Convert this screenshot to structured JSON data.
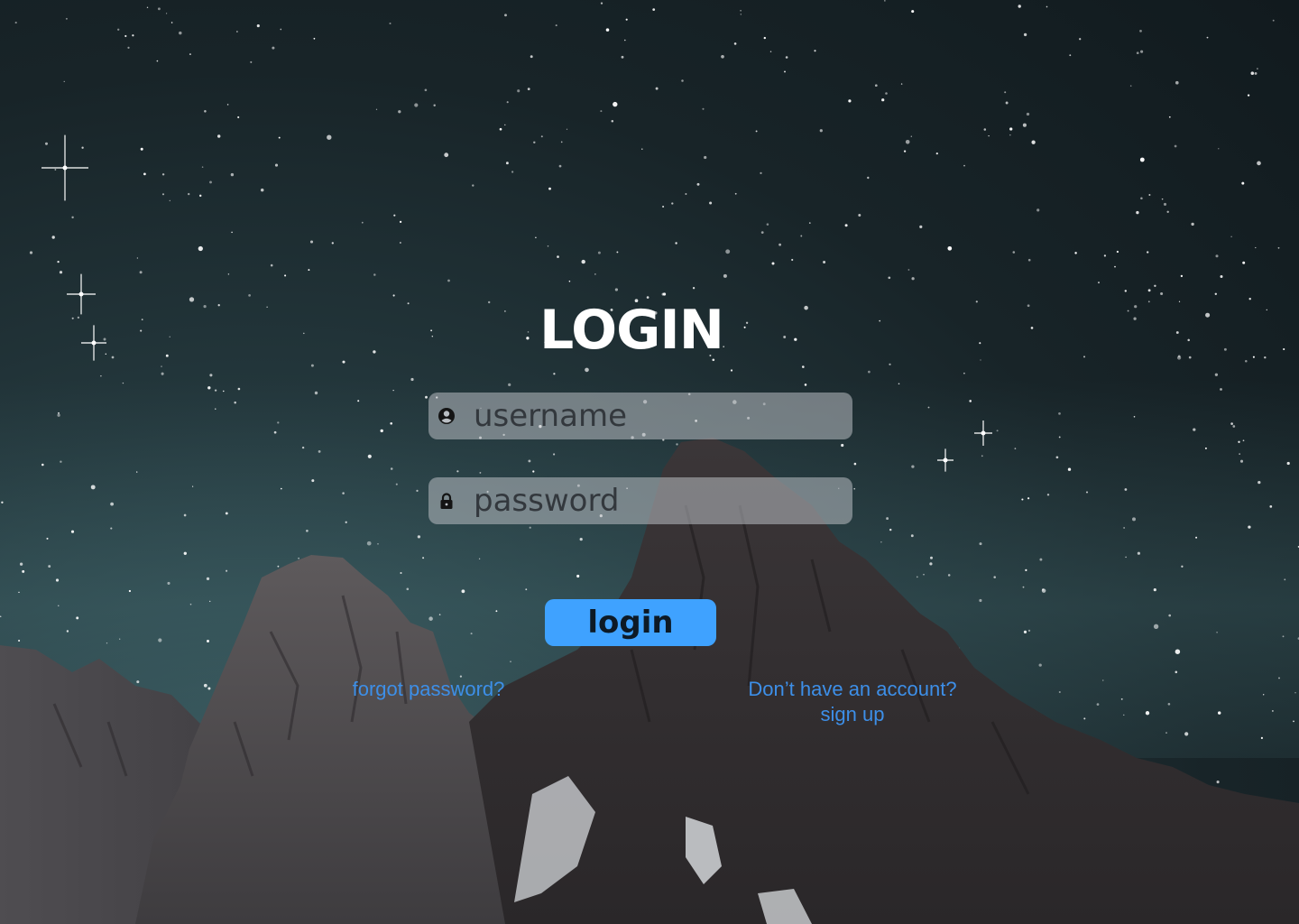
{
  "title": "LOGIN",
  "username_field": {
    "placeholder": "username",
    "value": "",
    "icon": "user-circle-icon"
  },
  "password_field": {
    "placeholder": "password",
    "value": "",
    "icon": "lock-icon"
  },
  "login_button": {
    "label": "login"
  },
  "links": {
    "forgot_password": "forgot password?",
    "no_account": "Don’t have an account?",
    "sign_up": "sign up"
  },
  "colors": {
    "accent": "#3fa2ff",
    "link": "#3d8fe8",
    "title": "#ffffff",
    "field_bg": "#b9bec3"
  }
}
